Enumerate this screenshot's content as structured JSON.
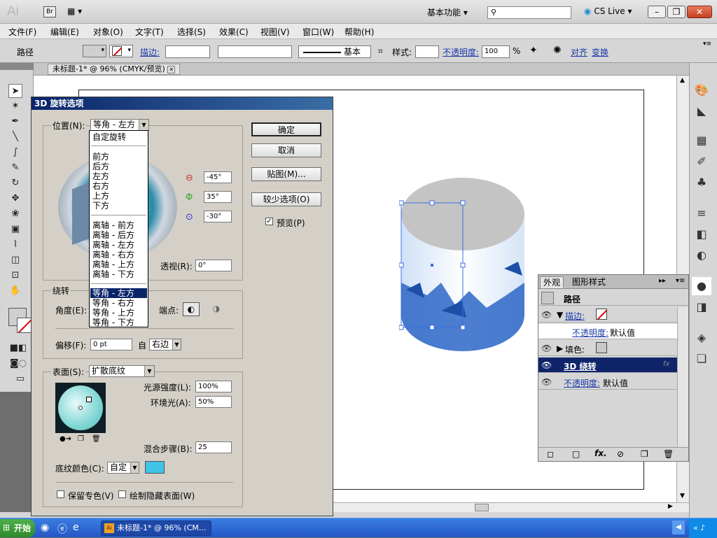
{
  "app": {
    "logo": "Ai",
    "bridge": "Br",
    "workspace": "基本功能",
    "cslive": "CS Live"
  },
  "menu": [
    "文件(F)",
    "编辑(E)",
    "对象(O)",
    "文字(T)",
    "选择(S)",
    "效果(C)",
    "视图(V)",
    "窗口(W)",
    "帮助(H)"
  ],
  "control": {
    "object_type": "路径",
    "stroke_label": "描边:",
    "stroke_style": "基本",
    "style_label": "样式:",
    "opacity_label": "不透明度:",
    "opacity_value": "100",
    "opacity_unit": "%",
    "align_label": "对齐",
    "transform_label": "变换"
  },
  "doc_tab": "未标题-1* @ 96% (CMYK/预览)",
  "dialog": {
    "title": "3D 旋转选项",
    "position_label": "位置(N):",
    "position_value": "等角 - 左方",
    "dropdown_items": [
      "自定旋转",
      "前方",
      "后方",
      "左方",
      "右方",
      "上方",
      "下方",
      "离轴 - 前方",
      "离轴 - 后方",
      "离轴 - 左方",
      "离轴 - 右方",
      "离轴 - 上方",
      "离轴 - 下方",
      "等角 - 左方",
      "等角 - 右方",
      "等角 - 上方",
      "等角 - 下方"
    ],
    "rot_x": "-45°",
    "rot_y": "35°",
    "rot_z": "-30°",
    "perspective_label": "透视(R):",
    "perspective_value": "0°",
    "extrude_group": "绕转",
    "angle_label": "角度(E):",
    "cap_label": "端点:",
    "offset_label": "偏移(F):",
    "offset_value": "0 pt",
    "from_label": "自",
    "from_value": "右边",
    "surface_label": "表面(S):",
    "surface_value": "扩散底纹",
    "light_intensity_label": "光源强度(L):",
    "light_intensity_value": "100%",
    "ambient_label": "环境光(A):",
    "ambient_value": "50%",
    "blend_label": "混合步骤(B):",
    "blend_value": "25",
    "shade_label": "底纹颜色(C):",
    "shade_value": "自定",
    "shade_color": "#3fc3e8",
    "preserve_label": "保留专色(V)",
    "hidden_label": "绘制隐藏表面(W)",
    "ok": "确定",
    "cancel": "取消",
    "map": "贴图(M)...",
    "fewer": "较少选项(O)",
    "preview": "预览(P)"
  },
  "appearance": {
    "tabs": [
      "外观",
      "图形样式"
    ],
    "object": "路径",
    "rows": [
      {
        "label": "描边:",
        "link": true
      },
      {
        "label": "不透明度:",
        "value": "默认值",
        "link": true
      },
      {
        "label": "填色:",
        "link": false
      },
      {
        "label": "3D 绕转",
        "link": true
      },
      {
        "label": "不透明度:",
        "value": "默认值",
        "link": true
      }
    ],
    "fx": "fx"
  },
  "taskbar": {
    "start": "开始",
    "task": "未标题-1* @ 96% (CM..."
  }
}
